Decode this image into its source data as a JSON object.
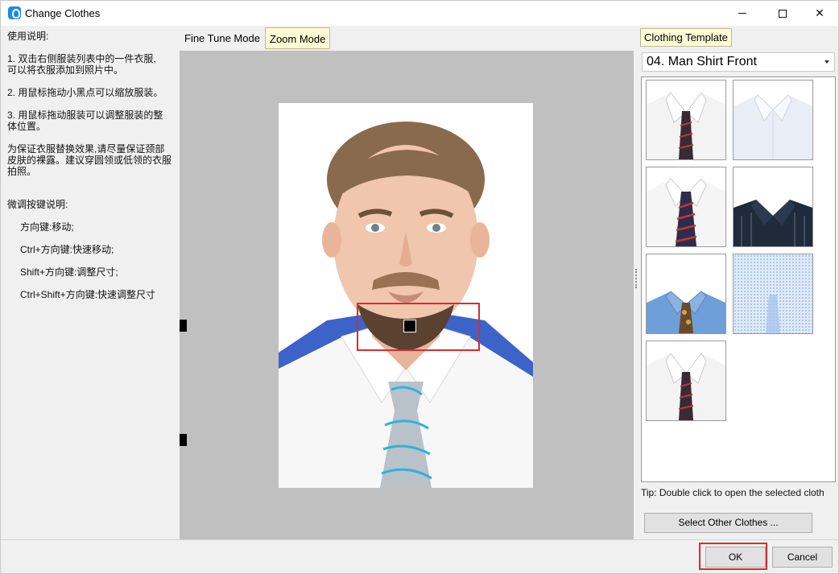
{
  "window": {
    "title": "Change Clothes",
    "icon": "app-logo-icon",
    "controls": [
      "minimize-icon",
      "maximize-icon",
      "close-icon"
    ]
  },
  "instructions": {
    "heading": "使用说明:",
    "step1_line1": "1. 双击右侧服装列表中的一件衣服,",
    "step1_line2": "可以将衣服添加到照片中。",
    "step2": "2. 用鼠标拖动小黑点可以缩放服装。",
    "step3_line1": "3. 用鼠标拖动服装可以调整服装的整",
    "step3_line2": "体位置。",
    "note_line1": "为保证衣服替换效果,请尽量保证颈部",
    "note_line2": "皮肤的裸露。建议穿圆领或低领的衣服",
    "note_line3": "拍照。",
    "keys_heading": "微调按键说明:",
    "key1": "方向键:移动;",
    "key2": "Ctrl+方向键:快速移动;",
    "key3": "Shift+方向键:调整尺寸;",
    "key4": "Ctrl+Shift+方向键:快速调整尺寸"
  },
  "tabs": {
    "fine_tune": "Fine Tune Mode",
    "zoom": "Zoom Mode"
  },
  "right_panel": {
    "label": "Clothing Template",
    "selected_template": "04. Man Shirt Front",
    "tip": "Tip: Double click to open the selected cloth",
    "select_other": "Select Other Clothes ..."
  },
  "thumbnails": [
    {
      "kind": "white-shirt-dark-tie"
    },
    {
      "kind": "white-shirt-no-tie"
    },
    {
      "kind": "white-shirt-striped-tie"
    },
    {
      "kind": "dark-striped-shirt"
    },
    {
      "kind": "blue-shirt-pattern-tie"
    },
    {
      "kind": "light-blue-pattern"
    },
    {
      "kind": "white-shirt-dark-tie-2"
    }
  ],
  "buttons": {
    "ok": "OK",
    "cancel": "Cancel"
  },
  "colors": {
    "highlight_red": "#d32f2f",
    "tooltip_yellow": "#fffbd5",
    "canvas_gray": "#c0c0c0"
  }
}
